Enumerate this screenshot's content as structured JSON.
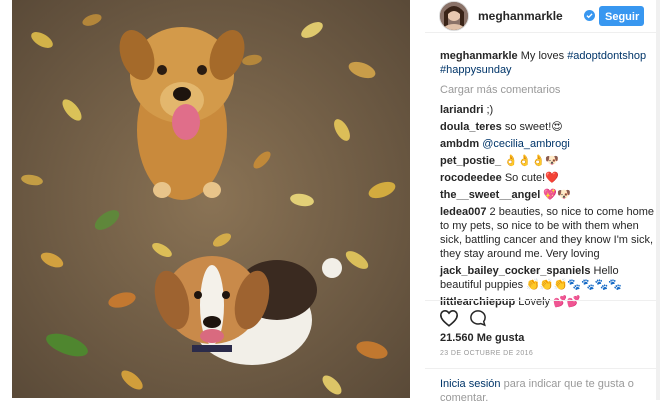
{
  "header": {
    "username": "meghanmarkle",
    "follow_label": "Seguir"
  },
  "caption": {
    "username": "meghanmarkle",
    "text": "My loves",
    "tag1": "#adoptdontshop",
    "tag2": "#happysunday"
  },
  "load_more": "Cargar más comentarios",
  "comments": [
    {
      "user": "lariandri",
      "text": ";)"
    },
    {
      "user": "doula_teres",
      "text": "so sweet!😍"
    },
    {
      "user": "ambdm",
      "text": "",
      "mention": "@cecilia_ambrogi"
    },
    {
      "user": "pet_postie_",
      "text": "👌👌👌🐶"
    },
    {
      "user": "rocodeedee",
      "text": "So cute!❤️"
    },
    {
      "user": "the__sweet__angel",
      "text": "💖🐶"
    },
    {
      "user": "ledea007",
      "text": "2 beauties, so nice to come home to my pets, so nice to be with them when sick, battling cancer and they know I'm sick, they stay around me. Very loving"
    },
    {
      "user": "jack_bailey_cocker_spaniels",
      "text": "Hello beautiful puppies 👏👏👏🐾🐾🐾🐾"
    },
    {
      "user": "littlearchiepup",
      "text": "Lovely 💕💕"
    }
  ],
  "likes": "21.560 Me gusta",
  "date": "23 DE OCTUBRE DE 2016",
  "login": {
    "link": "Inicia sesión",
    "rest": "para indicar que te gusta o comentar."
  },
  "icons": {
    "verified": "verified-badge-icon",
    "like": "heart-icon",
    "comment": "comment-bubble-icon"
  },
  "colors": {
    "accent": "#3897f0",
    "link": "#003569",
    "muted": "#999999"
  }
}
